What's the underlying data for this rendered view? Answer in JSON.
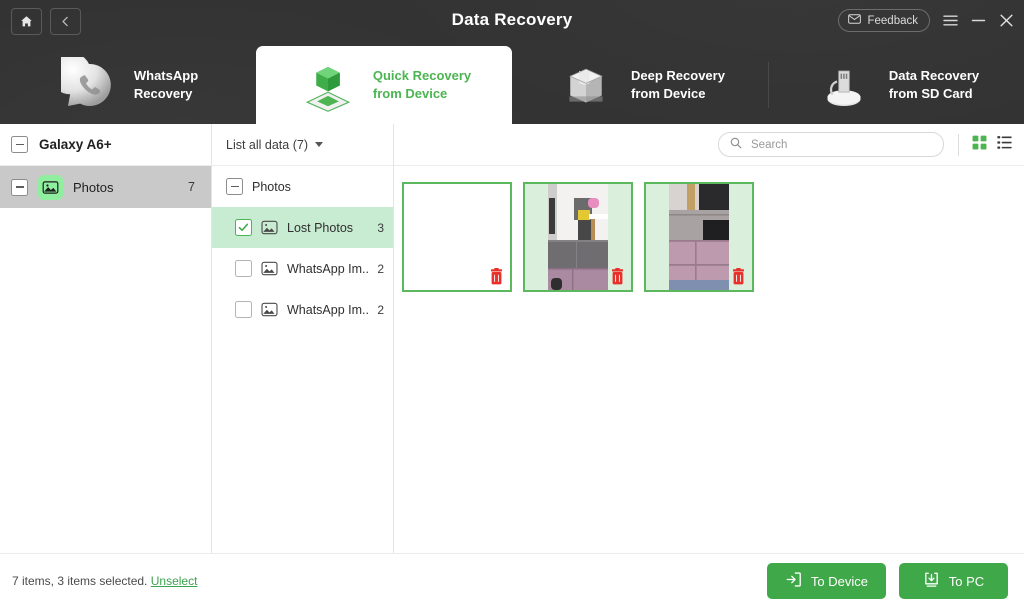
{
  "window": {
    "title": "Data Recovery",
    "feedback_label": "Feedback",
    "home_icon": "home-icon",
    "back_icon": "chevron-left-icon",
    "menu_icon": "hamburger-menu-icon",
    "minimize_icon": "minimize-icon",
    "close_icon": "close-icon",
    "mail_icon": "mail-icon"
  },
  "tabs": [
    {
      "label": "WhatsApp\nRecovery",
      "icon": "whatsapp-phone-icon",
      "active": false
    },
    {
      "label": "Quick Recovery\nfrom Device",
      "icon": "green-cube-icon",
      "active": true
    },
    {
      "label": "Deep Recovery\nfrom Device",
      "icon": "open-box-icon",
      "active": false
    },
    {
      "label": "Data Recovery\nfrom SD Card",
      "icon": "sd-card-reader-icon",
      "active": false
    }
  ],
  "sidebar": {
    "device_name": "Galaxy A6+",
    "device_expander_icon": "collapse-minus-icon",
    "categories": [
      {
        "label": "Photos",
        "count": "7",
        "icon": "photo-icon",
        "expander_icon": "collapse-minus-icon",
        "selected": true
      }
    ]
  },
  "tree_panel": {
    "list_all_label": "List all data (7)",
    "dropdown_icon": "chevron-down-icon",
    "nodes": [
      {
        "label": "Photos",
        "count": "",
        "type": "group",
        "expander_icon": "collapse-minus-icon",
        "checked": false,
        "selected": false
      },
      {
        "label": "Lost Photos",
        "count": "3",
        "type": "child",
        "icon": "photo-icon",
        "checked": true,
        "selected": true
      },
      {
        "label": "WhatsApp Im...",
        "count": "2",
        "type": "child",
        "icon": "photo-icon",
        "checked": false,
        "selected": false
      },
      {
        "label": "WhatsApp Im...",
        "count": "2",
        "type": "child",
        "icon": "photo-icon",
        "checked": false,
        "selected": false
      }
    ]
  },
  "content": {
    "search": {
      "value": "",
      "placeholder": "Search",
      "icon": "search-icon"
    },
    "view_modes": [
      {
        "name": "grid-view",
        "icon": "grid-view-icon",
        "active": true
      },
      {
        "name": "list-view",
        "icon": "list-view-icon",
        "active": false
      }
    ],
    "thumbnails": [
      {
        "label": "",
        "deleted_icon": "trash-icon",
        "selected": true,
        "blank": true
      },
      {
        "label": "",
        "deleted_icon": "trash-icon",
        "selected": true,
        "blank": false
      },
      {
        "label": "",
        "deleted_icon": "trash-icon",
        "selected": true,
        "blank": false
      }
    ]
  },
  "footer": {
    "status_prefix": "7 items, 3 items selected.",
    "unselect_label": "Unselect",
    "buttons": [
      {
        "label": "To Device",
        "icon": "export-to-device-icon"
      },
      {
        "label": "To PC",
        "icon": "download-to-pc-icon"
      }
    ]
  },
  "colors": {
    "accent_green": "#3fa848",
    "tab_active_green": "#4cb551",
    "dark_header": "#333333",
    "selected_row": "#c8ecd1",
    "sidebar_selected": "#c9c9c9",
    "trash_red": "#e8312a"
  }
}
